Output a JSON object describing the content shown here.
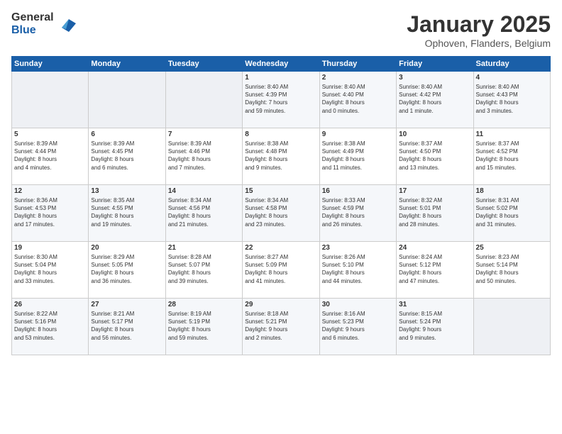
{
  "logo": {
    "line1": "General",
    "line2": "Blue"
  },
  "title": "January 2025",
  "subtitle": "Ophoven, Flanders, Belgium",
  "weekdays": [
    "Sunday",
    "Monday",
    "Tuesday",
    "Wednesday",
    "Thursday",
    "Friday",
    "Saturday"
  ],
  "weeks": [
    [
      {
        "day": "",
        "detail": ""
      },
      {
        "day": "",
        "detail": ""
      },
      {
        "day": "",
        "detail": ""
      },
      {
        "day": "1",
        "detail": "Sunrise: 8:40 AM\nSunset: 4:39 PM\nDaylight: 7 hours\nand 59 minutes."
      },
      {
        "day": "2",
        "detail": "Sunrise: 8:40 AM\nSunset: 4:40 PM\nDaylight: 8 hours\nand 0 minutes."
      },
      {
        "day": "3",
        "detail": "Sunrise: 8:40 AM\nSunset: 4:42 PM\nDaylight: 8 hours\nand 1 minute."
      },
      {
        "day": "4",
        "detail": "Sunrise: 8:40 AM\nSunset: 4:43 PM\nDaylight: 8 hours\nand 3 minutes."
      }
    ],
    [
      {
        "day": "5",
        "detail": "Sunrise: 8:39 AM\nSunset: 4:44 PM\nDaylight: 8 hours\nand 4 minutes."
      },
      {
        "day": "6",
        "detail": "Sunrise: 8:39 AM\nSunset: 4:45 PM\nDaylight: 8 hours\nand 6 minutes."
      },
      {
        "day": "7",
        "detail": "Sunrise: 8:39 AM\nSunset: 4:46 PM\nDaylight: 8 hours\nand 7 minutes."
      },
      {
        "day": "8",
        "detail": "Sunrise: 8:38 AM\nSunset: 4:48 PM\nDaylight: 8 hours\nand 9 minutes."
      },
      {
        "day": "9",
        "detail": "Sunrise: 8:38 AM\nSunset: 4:49 PM\nDaylight: 8 hours\nand 11 minutes."
      },
      {
        "day": "10",
        "detail": "Sunrise: 8:37 AM\nSunset: 4:50 PM\nDaylight: 8 hours\nand 13 minutes."
      },
      {
        "day": "11",
        "detail": "Sunrise: 8:37 AM\nSunset: 4:52 PM\nDaylight: 8 hours\nand 15 minutes."
      }
    ],
    [
      {
        "day": "12",
        "detail": "Sunrise: 8:36 AM\nSunset: 4:53 PM\nDaylight: 8 hours\nand 17 minutes."
      },
      {
        "day": "13",
        "detail": "Sunrise: 8:35 AM\nSunset: 4:55 PM\nDaylight: 8 hours\nand 19 minutes."
      },
      {
        "day": "14",
        "detail": "Sunrise: 8:34 AM\nSunset: 4:56 PM\nDaylight: 8 hours\nand 21 minutes."
      },
      {
        "day": "15",
        "detail": "Sunrise: 8:34 AM\nSunset: 4:58 PM\nDaylight: 8 hours\nand 23 minutes."
      },
      {
        "day": "16",
        "detail": "Sunrise: 8:33 AM\nSunset: 4:59 PM\nDaylight: 8 hours\nand 26 minutes."
      },
      {
        "day": "17",
        "detail": "Sunrise: 8:32 AM\nSunset: 5:01 PM\nDaylight: 8 hours\nand 28 minutes."
      },
      {
        "day": "18",
        "detail": "Sunrise: 8:31 AM\nSunset: 5:02 PM\nDaylight: 8 hours\nand 31 minutes."
      }
    ],
    [
      {
        "day": "19",
        "detail": "Sunrise: 8:30 AM\nSunset: 5:04 PM\nDaylight: 8 hours\nand 33 minutes."
      },
      {
        "day": "20",
        "detail": "Sunrise: 8:29 AM\nSunset: 5:05 PM\nDaylight: 8 hours\nand 36 minutes."
      },
      {
        "day": "21",
        "detail": "Sunrise: 8:28 AM\nSunset: 5:07 PM\nDaylight: 8 hours\nand 39 minutes."
      },
      {
        "day": "22",
        "detail": "Sunrise: 8:27 AM\nSunset: 5:09 PM\nDaylight: 8 hours\nand 41 minutes."
      },
      {
        "day": "23",
        "detail": "Sunrise: 8:26 AM\nSunset: 5:10 PM\nDaylight: 8 hours\nand 44 minutes."
      },
      {
        "day": "24",
        "detail": "Sunrise: 8:24 AM\nSunset: 5:12 PM\nDaylight: 8 hours\nand 47 minutes."
      },
      {
        "day": "25",
        "detail": "Sunrise: 8:23 AM\nSunset: 5:14 PM\nDaylight: 8 hours\nand 50 minutes."
      }
    ],
    [
      {
        "day": "26",
        "detail": "Sunrise: 8:22 AM\nSunset: 5:16 PM\nDaylight: 8 hours\nand 53 minutes."
      },
      {
        "day": "27",
        "detail": "Sunrise: 8:21 AM\nSunset: 5:17 PM\nDaylight: 8 hours\nand 56 minutes."
      },
      {
        "day": "28",
        "detail": "Sunrise: 8:19 AM\nSunset: 5:19 PM\nDaylight: 8 hours\nand 59 minutes."
      },
      {
        "day": "29",
        "detail": "Sunrise: 8:18 AM\nSunset: 5:21 PM\nDaylight: 9 hours\nand 2 minutes."
      },
      {
        "day": "30",
        "detail": "Sunrise: 8:16 AM\nSunset: 5:23 PM\nDaylight: 9 hours\nand 6 minutes."
      },
      {
        "day": "31",
        "detail": "Sunrise: 8:15 AM\nSunset: 5:24 PM\nDaylight: 9 hours\nand 9 minutes."
      },
      {
        "day": "",
        "detail": ""
      }
    ]
  ]
}
